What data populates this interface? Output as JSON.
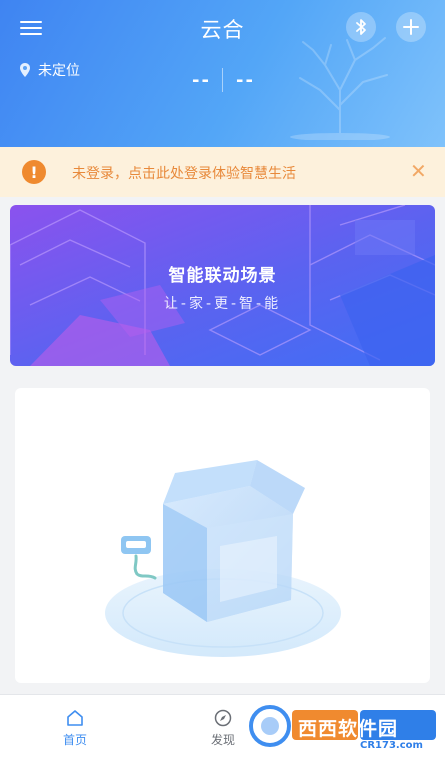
{
  "header": {
    "title": "云合",
    "location": "未定位",
    "readout_left": "--",
    "readout_right": "--"
  },
  "notice": {
    "text": "未登录，点击此处登录体验智慧生活",
    "icon_symbol": "!",
    "close_symbol": "✕"
  },
  "banner": {
    "title": "智能联动场景",
    "subtitle": "让-家-更-智-能"
  },
  "tabs": [
    {
      "label": "首页",
      "icon": "home-icon"
    },
    {
      "label": "发现",
      "icon": "compass-icon"
    }
  ],
  "watermark": {
    "brand": "西西软件园",
    "site": "CR173.com"
  },
  "colors": {
    "header_start": "#3f84f2",
    "header_end": "#7fc2fb",
    "notice_bg": "#fdf1dc",
    "notice_text": "#e8893a",
    "notice_icon": "#ef8a2f",
    "active_tab": "#3f8ef0"
  }
}
